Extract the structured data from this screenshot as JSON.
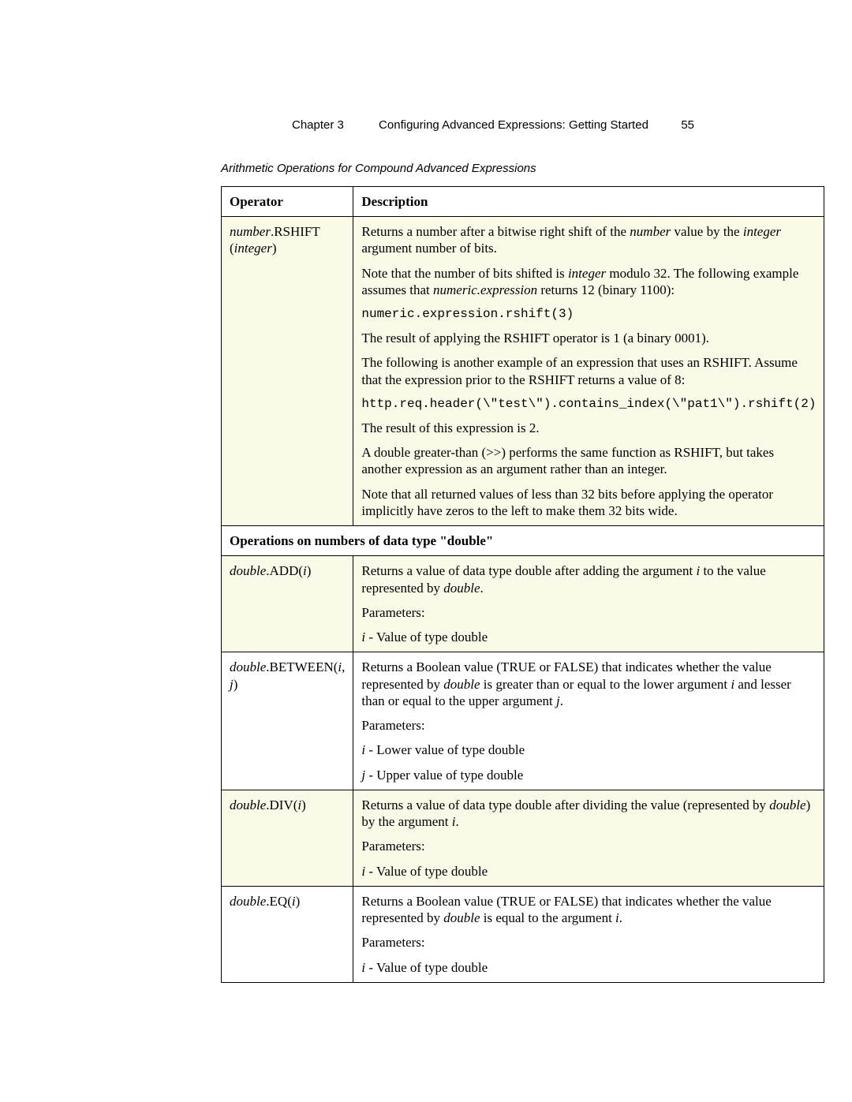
{
  "header": {
    "chapter": "Chapter 3",
    "title": "Configuring Advanced Expressions: Getting Started",
    "page_number": "55"
  },
  "caption": "Arithmetic Operations for Compound Advanced Expressions",
  "columns": {
    "operator": "Operator",
    "description": "Description"
  },
  "rshift": {
    "op_italic": "number",
    "op_suffix": ".RSHIFT",
    "op_line2_open": "(",
    "op_line2_italic": "integer",
    "op_line2_close": ")",
    "p1a": "Returns a number after a bitwise right shift of the ",
    "p1_number": "number",
    "p1b": " value by the ",
    "p1_integer": "integer",
    "p1c": " argument number of bits.",
    "p2a": "Note that the number of bits shifted is ",
    "p2_integer": "integer",
    "p2b": " modulo 32. The following example assumes that ",
    "p2_expr": "numeric.expression",
    "p2c": " returns 12 (binary 1100):",
    "code1": "numeric.expression.rshift(3)",
    "p3": "The result of applying the RSHIFT operator is 1 (a binary 0001).",
    "p4": "The following is another example of an expression that uses an RSHIFT. Assume that the expression prior to the RSHIFT returns a value of 8:",
    "code2": "http.req.header(\\\"test\\\").contains_index(\\\"pat1\\\").rshift(2)",
    "p5": "The result of this expression is 2.",
    "p6": "A double greater-than (>>) performs the same function as RSHIFT, but takes another expression as an argument rather than an integer.",
    "p7": "Note that all returned values of less than 32 bits before applying the operator implicitly have zeros to the left to make them 32 bits wide."
  },
  "section": "Operations on numbers of data type \"double\"",
  "add": {
    "op_pre": "double",
    "op_mid": ".ADD(",
    "op_arg": "i",
    "op_post": ")",
    "p1a": "Returns a value of data type double after adding the argument ",
    "p1_i": "i",
    "p1b": " to the value represented by ",
    "p1_double": "double",
    "p1c": ".",
    "p2": "Parameters:",
    "p3_i": "i",
    "p3b": " - Value of type double"
  },
  "between": {
    "op_pre": "double",
    "op_mid1": ".BETWEEN(",
    "op_i": "i",
    "op_sep": ", ",
    "op_j": "j",
    "op_post": ")",
    "p1a": "Returns a Boolean value (TRUE or FALSE) that indicates whether the value represented by ",
    "p1_double": "double",
    "p1b": " is greater than or equal to the lower argument ",
    "p1_i": "i",
    "p1c": " and lesser than or equal to the upper argument ",
    "p1_j": "j",
    "p1d": ".",
    "p2": "Parameters:",
    "p3_i": "i",
    "p3b": " - Lower value of type double",
    "p4_j": "j",
    "p4b": " - Upper value of type double"
  },
  "div": {
    "op_pre": "double",
    "op_mid": ".DIV(",
    "op_arg": "i",
    "op_post": ")",
    "p1a": "Returns a value of data type double after dividing the value (represented by ",
    "p1_double": "double",
    "p1b": ") by the argument ",
    "p1_i": "i",
    "p1c": ".",
    "p2": "Parameters:",
    "p3_i": "i",
    "p3b": " - Value of type double"
  },
  "eq": {
    "op_pre": "double",
    "op_mid": ".EQ(",
    "op_arg": "i",
    "op_post": ")",
    "p1a": "Returns a Boolean value (TRUE or FALSE) that indicates whether the value represented by ",
    "p1_double": "double",
    "p1b": " is equal to the argument ",
    "p1_i": "i",
    "p1c": ".",
    "p2": "Parameters:",
    "p3_i": "i",
    "p3b": " - Value of type double"
  }
}
